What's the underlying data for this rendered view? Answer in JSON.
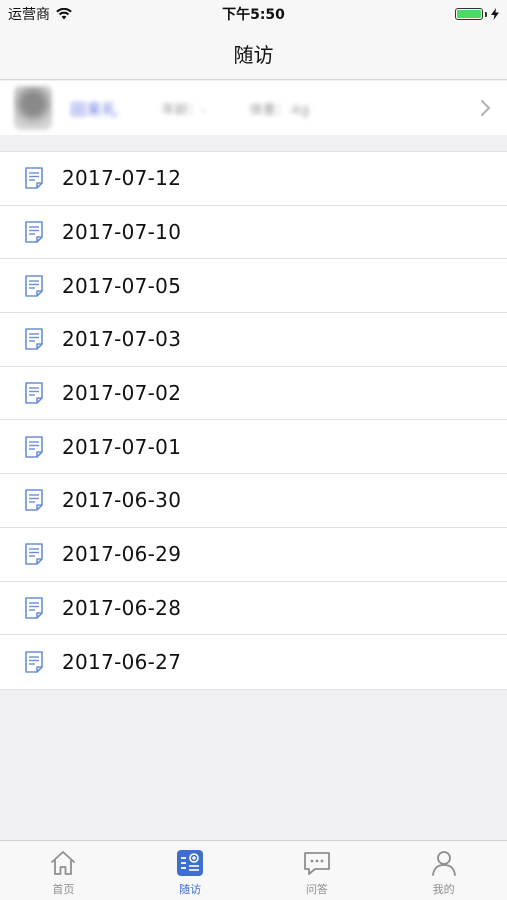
{
  "status_bar": {
    "carrier": "运营商",
    "time": "下午5:50"
  },
  "nav": {
    "title": "随访"
  },
  "patient": {
    "name": "田来礼",
    "age_text": "年龄：-",
    "weight_text": "体重：-kg"
  },
  "visits": [
    {
      "date": "2017-07-12"
    },
    {
      "date": "2017-07-10"
    },
    {
      "date": "2017-07-05"
    },
    {
      "date": "2017-07-03"
    },
    {
      "date": "2017-07-02"
    },
    {
      "date": "2017-07-01"
    },
    {
      "date": "2017-06-30"
    },
    {
      "date": "2017-06-29"
    },
    {
      "date": "2017-06-28"
    },
    {
      "date": "2017-06-27"
    }
  ],
  "tabs": [
    {
      "label": "首页",
      "icon": "home-icon"
    },
    {
      "label": "随访",
      "icon": "followup-icon"
    },
    {
      "label": "问答",
      "icon": "chat-icon"
    },
    {
      "label": "我的",
      "icon": "profile-icon"
    }
  ],
  "colors": {
    "accent": "#3e6fd0",
    "tab_inactive": "#8e8e93",
    "battery": "#4cd964"
  }
}
